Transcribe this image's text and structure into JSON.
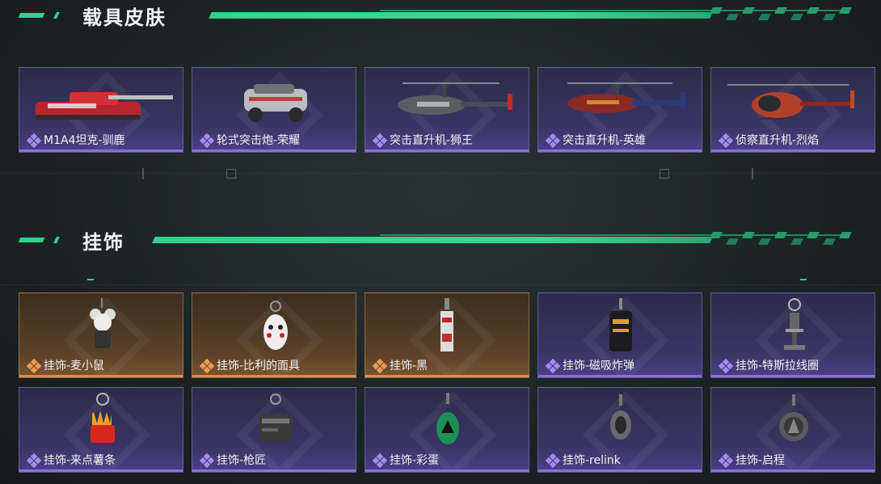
{
  "sections": [
    {
      "title": "载具皮肤",
      "items": [
        {
          "label": "M1A4坦克-驯鹿",
          "rarity": "purple",
          "icon": "tank-icon"
        },
        {
          "label": "轮式突击炮-荣耀",
          "rarity": "purple",
          "icon": "armored-car-icon"
        },
        {
          "label": "突击直升机-狮王",
          "rarity": "purple",
          "icon": "helicopter-icon"
        },
        {
          "label": "突击直升机-英雄",
          "rarity": "purple",
          "icon": "helicopter-icon"
        },
        {
          "label": "侦察直升机-烈焰",
          "rarity": "purple",
          "icon": "scout-helicopter-icon"
        }
      ]
    },
    {
      "title": "挂饰",
      "items": [
        {
          "label": "挂饰-麦小鼠",
          "rarity": "gold",
          "icon": "mouse-charm-icon"
        },
        {
          "label": "挂饰-比利的面具",
          "rarity": "gold",
          "icon": "mask-charm-icon"
        },
        {
          "label": "挂饰-黑",
          "rarity": "gold",
          "icon": "tag-charm-icon"
        },
        {
          "label": "挂饰-磁吸炸弹",
          "rarity": "purple",
          "icon": "bomb-charm-icon"
        },
        {
          "label": "挂饰-特斯拉线圈",
          "rarity": "purple",
          "icon": "coil-charm-icon"
        },
        {
          "label": "挂饰-来点薯条",
          "rarity": "purple",
          "icon": "fries-charm-icon"
        },
        {
          "label": "挂饰-枪匠",
          "rarity": "purple",
          "icon": "gunsmith-charm-icon"
        },
        {
          "label": "挂饰-彩蛋",
          "rarity": "purple",
          "icon": "egg-charm-icon"
        },
        {
          "label": "挂饰-relink",
          "rarity": "purple",
          "icon": "relink-charm-icon"
        },
        {
          "label": "挂饰-启程",
          "rarity": "purple",
          "icon": "medallion-charm-icon"
        }
      ]
    }
  ],
  "colors": {
    "accent_green": "#2fd38f",
    "purple": "#8e6de0",
    "gold": "#e2894a"
  }
}
